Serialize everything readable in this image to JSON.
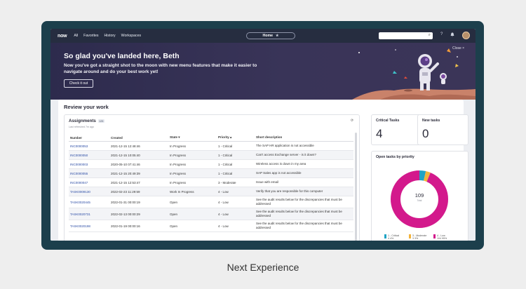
{
  "topbar": {
    "logo": "now",
    "nav": [
      "All",
      "Favorites",
      "History",
      "Workspaces"
    ],
    "home_label": "Home",
    "star_icon": "★",
    "search_icon": "⌕",
    "help_icon": "?",
    "bell_icon": "🔔"
  },
  "banner": {
    "title": "So glad you've landed here, Beth",
    "text": "Now you've got a straight shot to the moon with new menu features that make it easier to navigate around and do your best work yet!",
    "button": "Check it out",
    "close": "Close ×"
  },
  "review": {
    "title": "Review your work",
    "assignments": {
      "title": "Assignments",
      "badge": "125",
      "subtitle": "Last refreshed 7m ago",
      "refresh_icon": "⟳",
      "columns": [
        "Number",
        "Created",
        "State ▾",
        "Priority ▴",
        "Short description"
      ],
      "rows": [
        {
          "number": "INC0000053",
          "created": "2021-12-15 12:48:46",
          "state": "In Progress",
          "priority": "1 - Critical",
          "desc": "The SAP HR application is not accessible"
        },
        {
          "number": "INC0000050",
          "created": "2021-12-15 10:05:40",
          "state": "In Progress",
          "priority": "1 - Critical",
          "desc": "Can't access Exchange server - is it down?"
        },
        {
          "number": "INC0000003",
          "created": "2020-05-10 07:41:46",
          "state": "In Progress",
          "priority": "1 - Critical",
          "desc": "Wireless access is down in my area"
        },
        {
          "number": "INC0000055",
          "created": "2021-12-15 20:49:39",
          "state": "In Progress",
          "priority": "1 - Critical",
          "desc": "SAP Sales app is not accessible"
        },
        {
          "number": "INC0000047",
          "created": "2021-12-15 12:53:47",
          "state": "In Progress",
          "priority": "3 - Moderate",
          "desc": "Issue with email"
        },
        {
          "number": "TASK0009130",
          "created": "2022-02-23 11:29:59",
          "state": "Work In Progress",
          "priority": "4 - Low",
          "desc": "Verify that you are responsible for this computer"
        },
        {
          "number": "TASK0020445",
          "created": "2022-01-31 00:00:19",
          "state": "Open",
          "priority": "4 - Low",
          "desc": "See the audit results below for the discrepancies that must be addressed"
        },
        {
          "number": "TASK0020731",
          "created": "2022-02-13 00:00:29",
          "state": "Open",
          "priority": "4 - Low",
          "desc": "See the audit results below for the discrepancies that must be addressed"
        },
        {
          "number": "TASK0020198",
          "created": "2022-01-19 00:00:16",
          "state": "Open",
          "priority": "4 - Low",
          "desc": "See the audit results below for the discrepancies that must be addressed"
        }
      ]
    },
    "critical": {
      "label": "Critical Tasks",
      "value": "4"
    },
    "new_tasks": {
      "label": "New tasks",
      "value": "0"
    },
    "priority_chart": {
      "title": "Open tasks by priority",
      "total": "109",
      "total_sub": "Total",
      "legend": [
        {
          "label": "1 - Critical",
          "value": "4",
          "pct": "4%",
          "color": "#1fa3c4"
        },
        {
          "label": "3 - Moderate",
          "value": "3",
          "pct": "3%",
          "color": "#f2b33b"
        },
        {
          "label": "4 - Low",
          "value": "104",
          "pct": "95%",
          "color": "#d3198c"
        }
      ]
    }
  },
  "caption": "Next Experience",
  "colors": {
    "frame": "#1c3f4c",
    "topbar": "#262d40",
    "link": "#2e4ea6",
    "critical": "#1fa3c4",
    "moderate": "#f2b33b",
    "low": "#d3198c"
  }
}
